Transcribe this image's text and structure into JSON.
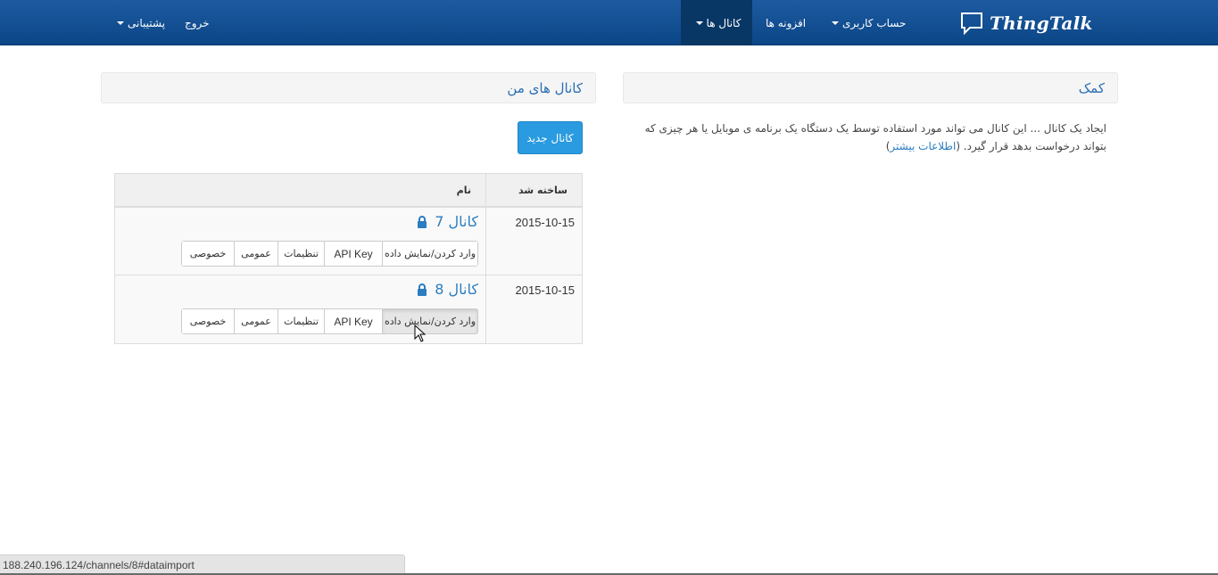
{
  "navbar": {
    "brand": "ThingTalk",
    "items": {
      "channels": "کانال ها",
      "plugins": "افزونه ها",
      "account": "حساب کاربری",
      "logout": "خروج",
      "support": "پشتیبانی"
    },
    "active_item": "channels"
  },
  "help_panel": {
    "title": "کمک",
    "text": "ایجاد یک کانال ... این کانال می تواند مورد استفاده توسط یک دستگاه یک برنامه ی موبایل یا هر چیزی که بتواند درخواست بدهد قرار گیرد. (",
    "link": "اطلاعات بیشتر"
  },
  "channels_panel": {
    "title": "کانال های من",
    "new_button": "کانال جدید",
    "table": {
      "headers": {
        "name": "نام",
        "created": "ساخته شد"
      },
      "rows": [
        {
          "name": "کانال 7",
          "created": "2015-10-15",
          "buttons": {
            "import": "وارد کردن/نمایش داده",
            "api": "API Key",
            "settings": "تنظیمات",
            "public": "عمومی",
            "private": "خصوصی"
          }
        },
        {
          "name": "کانال 8",
          "created": "2015-10-15",
          "buttons": {
            "import": "وارد کردن/نمایش داده",
            "api": "API Key",
            "settings": "تنظیمات",
            "public": "عمومی",
            "private": "خصوصی"
          }
        }
      ]
    }
  },
  "statusbar": {
    "url": "188.240.196.124/channels/8#dataimport"
  },
  "colors": {
    "navbar": "#0b4687",
    "link": "#2a7dc0",
    "primary_button": "#2a9be0"
  }
}
